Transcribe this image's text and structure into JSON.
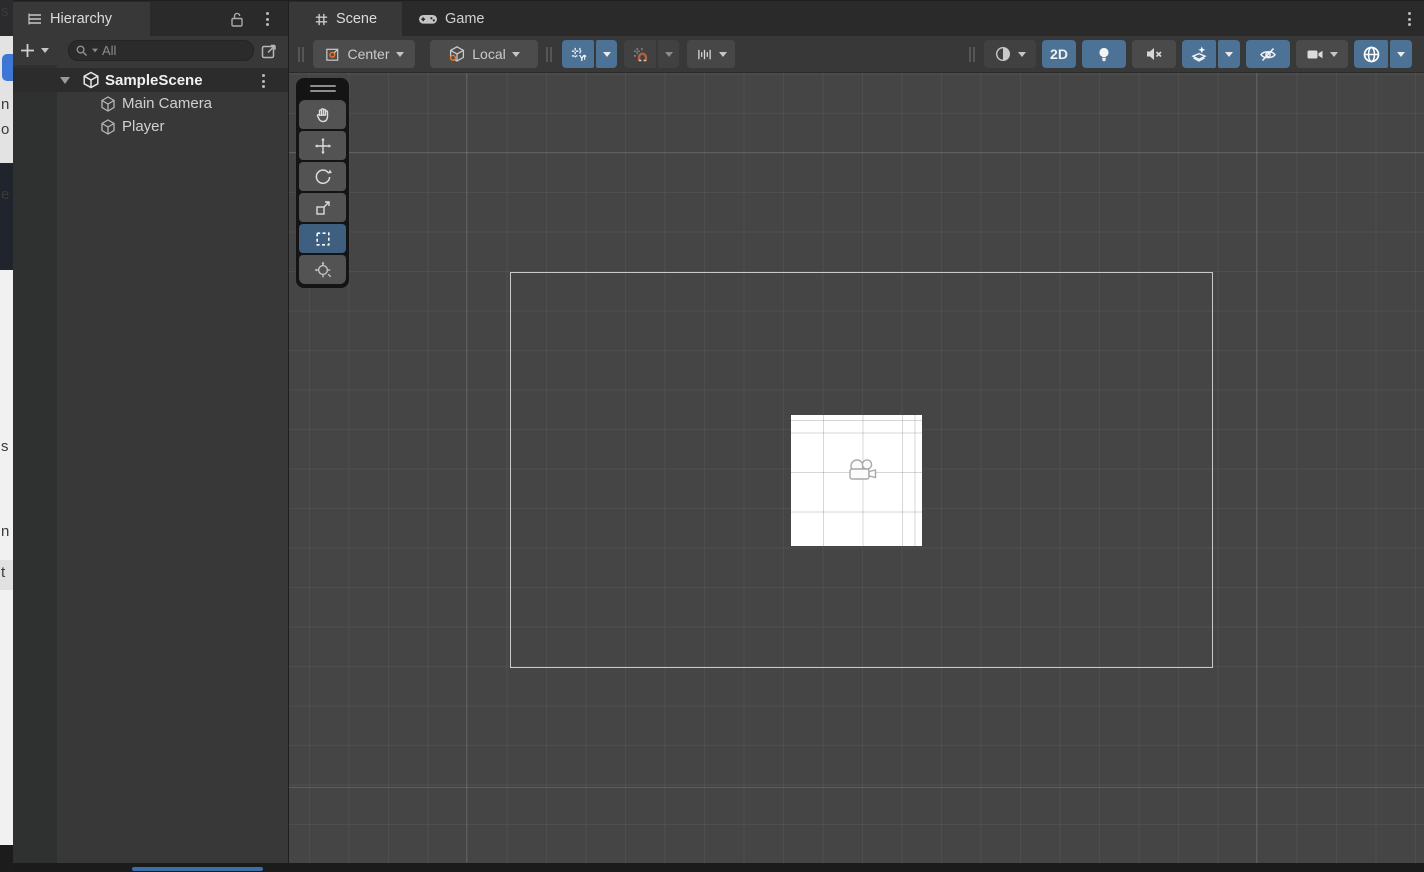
{
  "background_window": {
    "fragments": [
      "s",
      "n",
      "o",
      "e",
      "s",
      "n",
      "t"
    ]
  },
  "hierarchy": {
    "tab_label": "Hierarchy",
    "create_button_label": "+",
    "search_placeholder": "All",
    "scene_item": {
      "label": "SampleScene",
      "expanded": true,
      "selected_header": true
    },
    "items": [
      {
        "label": "Main Camera",
        "type": "gameobject"
      },
      {
        "label": "Player",
        "type": "gameobject"
      }
    ]
  },
  "scene": {
    "tabs": {
      "scene_label": "Scene",
      "game_label": "Game",
      "active": "Scene"
    },
    "toolbar": {
      "pivot_label": "Center",
      "rotation_label": "Local",
      "mode_2d_label": "2D",
      "toggles_active": [
        "grid-snap",
        "2d-mode",
        "scene-lighting",
        "scene-fx",
        "hidden-objects",
        "gizmos"
      ],
      "toggles_inactive": [
        "audio-mute",
        "snap-increment",
        "shading-mode",
        "camera-settings"
      ]
    },
    "tools": {
      "active_tool": "rect-tool",
      "list": [
        "view-hand-tool",
        "move-tool",
        "rotate-tool",
        "scale-tool",
        "rect-tool",
        "transform-tool"
      ]
    },
    "viewport": {
      "camera_frame_visible": true,
      "sprite": "white-square-sprite",
      "gizmo": "camera-gizmo"
    }
  },
  "icons": {
    "hierarchy_tab": "list-icon",
    "lock": "unlock-icon",
    "menu": "kebab-menu-icon",
    "search": "search-icon",
    "popout": "pick-window-icon",
    "scene_logo": "unity-cube-icon",
    "gameobject": "cube-icon",
    "scene_tab": "grid-hash-icon",
    "game_tab": "gamepad-icon",
    "pivot": "pivot-center-icon",
    "rotation": "local-cube-icon",
    "grid_snap": "grid-y-snap-icon",
    "snap_increment": "magnet-snap-icon",
    "unit_snap": "ruler-icon",
    "shading": "shading-sphere-icon",
    "lighting": "lightbulb-icon",
    "audio": "speaker-mute-icon",
    "fx": "effects-star-icon",
    "visibility": "eye-slash-icon",
    "camera": "video-camera-icon",
    "gizmos": "gizmo-globe-icon"
  },
  "colors": {
    "accent_blue": "#4c7296",
    "tool_selected_blue": "#3e5f80",
    "orange_accent": "#ee7525",
    "scrollbar_blue": "#3a6fa8",
    "viewport_bg": "#454545",
    "panel_bg": "#383838",
    "tabbar_bg": "#2a2a2a"
  }
}
